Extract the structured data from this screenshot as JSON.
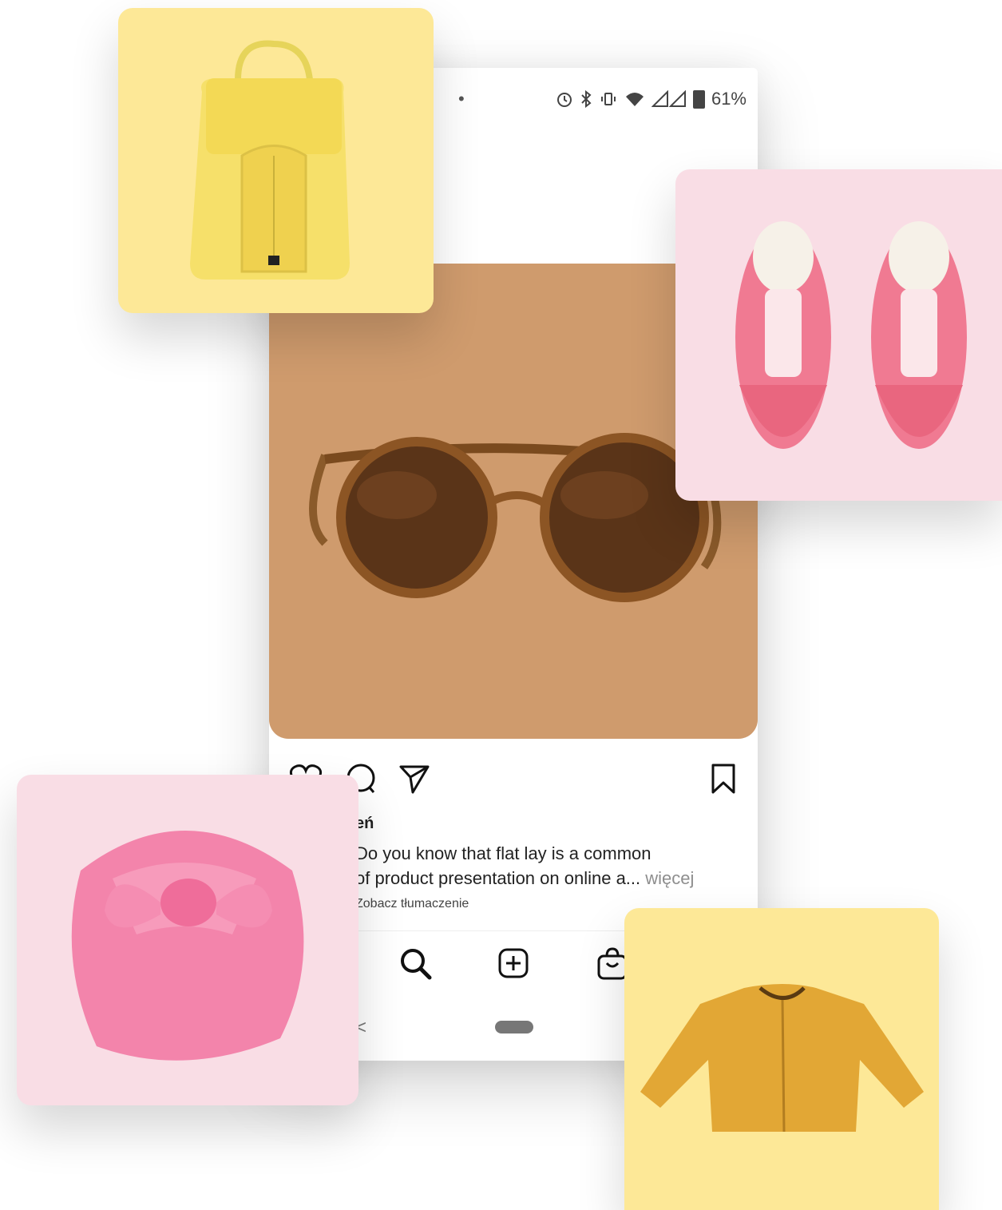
{
  "status_bar": {
    "dot": "•",
    "battery_text": "61%"
  },
  "post": {
    "username_fragment": "eń",
    "caption_line1": "Do you know that flat lay is a common",
    "caption_line2": "of product presentation on online a...",
    "more_label": "więcej",
    "translate_label": "Zobacz tłumaczenie"
  },
  "colors": {
    "post_bg": "#cf9b6d",
    "yellow_card": "#fde897",
    "pink_card": "#f9dde5"
  },
  "icons": {
    "like": "heart-icon",
    "comment": "comment-icon",
    "share": "send-icon",
    "save": "bookmark-icon",
    "search": "search-icon",
    "add": "add-post-icon",
    "shop": "shop-bag-icon"
  },
  "products": [
    "backpack",
    "sneakers",
    "sunglasses",
    "turban",
    "jacket"
  ]
}
